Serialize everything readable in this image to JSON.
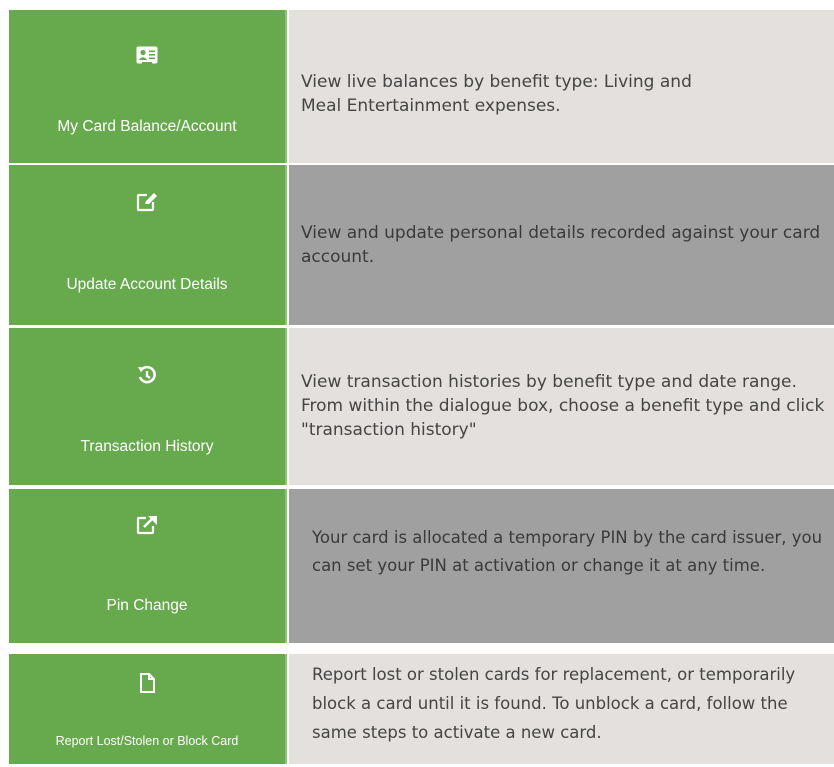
{
  "rows": [
    {
      "button_label": "My Card Balance/Account",
      "icon": "id-card-icon",
      "description": "View live balances by benefit type: Living and\nMeal Entertainment expenses."
    },
    {
      "button_label": "Update Account Details",
      "icon": "edit-icon",
      "description": "View and update personal details recorded against your card account."
    },
    {
      "button_label": "Transaction History",
      "icon": "history-icon",
      "description": "View transaction histories by benefit type and date range. From within the dialogue box, choose a benefit type and click \"transaction history\""
    },
    {
      "button_label": "Pin Change",
      "icon": "external-link-icon",
      "description": "Your card is allocated a temporary PIN by the card issuer, you can set your PIN at activation or change it at any time."
    },
    {
      "button_label": "Report Lost/Stolen or Block Card",
      "icon": "file-icon",
      "description": "Report lost or stolen cards for replacement, or temporarily block a card until it is found. To unblock a card, follow the same steps to activate a new card."
    }
  ],
  "colors": {
    "button_green": "#67a94d",
    "light_panel": "#e3e0dd",
    "dark_panel": "#a0a0a0"
  }
}
